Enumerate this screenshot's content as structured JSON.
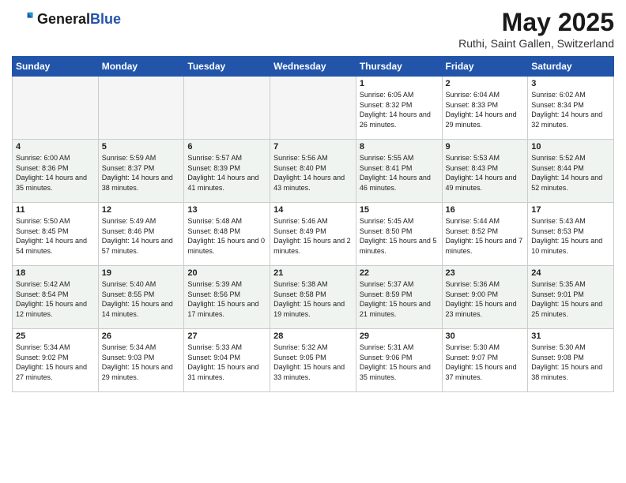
{
  "header": {
    "logo_general": "General",
    "logo_blue": "Blue",
    "month": "May 2025",
    "location": "Ruthi, Saint Gallen, Switzerland"
  },
  "days_of_week": [
    "Sunday",
    "Monday",
    "Tuesday",
    "Wednesday",
    "Thursday",
    "Friday",
    "Saturday"
  ],
  "weeks": [
    [
      {
        "day": "",
        "empty": true
      },
      {
        "day": "",
        "empty": true
      },
      {
        "day": "",
        "empty": true
      },
      {
        "day": "",
        "empty": true
      },
      {
        "day": "1",
        "sunrise": "6:05 AM",
        "sunset": "8:32 PM",
        "daylight": "14 hours and 26 minutes."
      },
      {
        "day": "2",
        "sunrise": "6:04 AM",
        "sunset": "8:33 PM",
        "daylight": "14 hours and 29 minutes."
      },
      {
        "day": "3",
        "sunrise": "6:02 AM",
        "sunset": "8:34 PM",
        "daylight": "14 hours and 32 minutes."
      }
    ],
    [
      {
        "day": "4",
        "sunrise": "6:00 AM",
        "sunset": "8:36 PM",
        "daylight": "14 hours and 35 minutes."
      },
      {
        "day": "5",
        "sunrise": "5:59 AM",
        "sunset": "8:37 PM",
        "daylight": "14 hours and 38 minutes."
      },
      {
        "day": "6",
        "sunrise": "5:57 AM",
        "sunset": "8:39 PM",
        "daylight": "14 hours and 41 minutes."
      },
      {
        "day": "7",
        "sunrise": "5:56 AM",
        "sunset": "8:40 PM",
        "daylight": "14 hours and 43 minutes."
      },
      {
        "day": "8",
        "sunrise": "5:55 AM",
        "sunset": "8:41 PM",
        "daylight": "14 hours and 46 minutes."
      },
      {
        "day": "9",
        "sunrise": "5:53 AM",
        "sunset": "8:43 PM",
        "daylight": "14 hours and 49 minutes."
      },
      {
        "day": "10",
        "sunrise": "5:52 AM",
        "sunset": "8:44 PM",
        "daylight": "14 hours and 52 minutes."
      }
    ],
    [
      {
        "day": "11",
        "sunrise": "5:50 AM",
        "sunset": "8:45 PM",
        "daylight": "14 hours and 54 minutes."
      },
      {
        "day": "12",
        "sunrise": "5:49 AM",
        "sunset": "8:46 PM",
        "daylight": "14 hours and 57 minutes."
      },
      {
        "day": "13",
        "sunrise": "5:48 AM",
        "sunset": "8:48 PM",
        "daylight": "15 hours and 0 minutes."
      },
      {
        "day": "14",
        "sunrise": "5:46 AM",
        "sunset": "8:49 PM",
        "daylight": "15 hours and 2 minutes."
      },
      {
        "day": "15",
        "sunrise": "5:45 AM",
        "sunset": "8:50 PM",
        "daylight": "15 hours and 5 minutes."
      },
      {
        "day": "16",
        "sunrise": "5:44 AM",
        "sunset": "8:52 PM",
        "daylight": "15 hours and 7 minutes."
      },
      {
        "day": "17",
        "sunrise": "5:43 AM",
        "sunset": "8:53 PM",
        "daylight": "15 hours and 10 minutes."
      }
    ],
    [
      {
        "day": "18",
        "sunrise": "5:42 AM",
        "sunset": "8:54 PM",
        "daylight": "15 hours and 12 minutes."
      },
      {
        "day": "19",
        "sunrise": "5:40 AM",
        "sunset": "8:55 PM",
        "daylight": "15 hours and 14 minutes."
      },
      {
        "day": "20",
        "sunrise": "5:39 AM",
        "sunset": "8:56 PM",
        "daylight": "15 hours and 17 minutes."
      },
      {
        "day": "21",
        "sunrise": "5:38 AM",
        "sunset": "8:58 PM",
        "daylight": "15 hours and 19 minutes."
      },
      {
        "day": "22",
        "sunrise": "5:37 AM",
        "sunset": "8:59 PM",
        "daylight": "15 hours and 21 minutes."
      },
      {
        "day": "23",
        "sunrise": "5:36 AM",
        "sunset": "9:00 PM",
        "daylight": "15 hours and 23 minutes."
      },
      {
        "day": "24",
        "sunrise": "5:35 AM",
        "sunset": "9:01 PM",
        "daylight": "15 hours and 25 minutes."
      }
    ],
    [
      {
        "day": "25",
        "sunrise": "5:34 AM",
        "sunset": "9:02 PM",
        "daylight": "15 hours and 27 minutes."
      },
      {
        "day": "26",
        "sunrise": "5:34 AM",
        "sunset": "9:03 PM",
        "daylight": "15 hours and 29 minutes."
      },
      {
        "day": "27",
        "sunrise": "5:33 AM",
        "sunset": "9:04 PM",
        "daylight": "15 hours and 31 minutes."
      },
      {
        "day": "28",
        "sunrise": "5:32 AM",
        "sunset": "9:05 PM",
        "daylight": "15 hours and 33 minutes."
      },
      {
        "day": "29",
        "sunrise": "5:31 AM",
        "sunset": "9:06 PM",
        "daylight": "15 hours and 35 minutes."
      },
      {
        "day": "30",
        "sunrise": "5:30 AM",
        "sunset": "9:07 PM",
        "daylight": "15 hours and 37 minutes."
      },
      {
        "day": "31",
        "sunrise": "5:30 AM",
        "sunset": "9:08 PM",
        "daylight": "15 hours and 38 minutes."
      }
    ]
  ]
}
